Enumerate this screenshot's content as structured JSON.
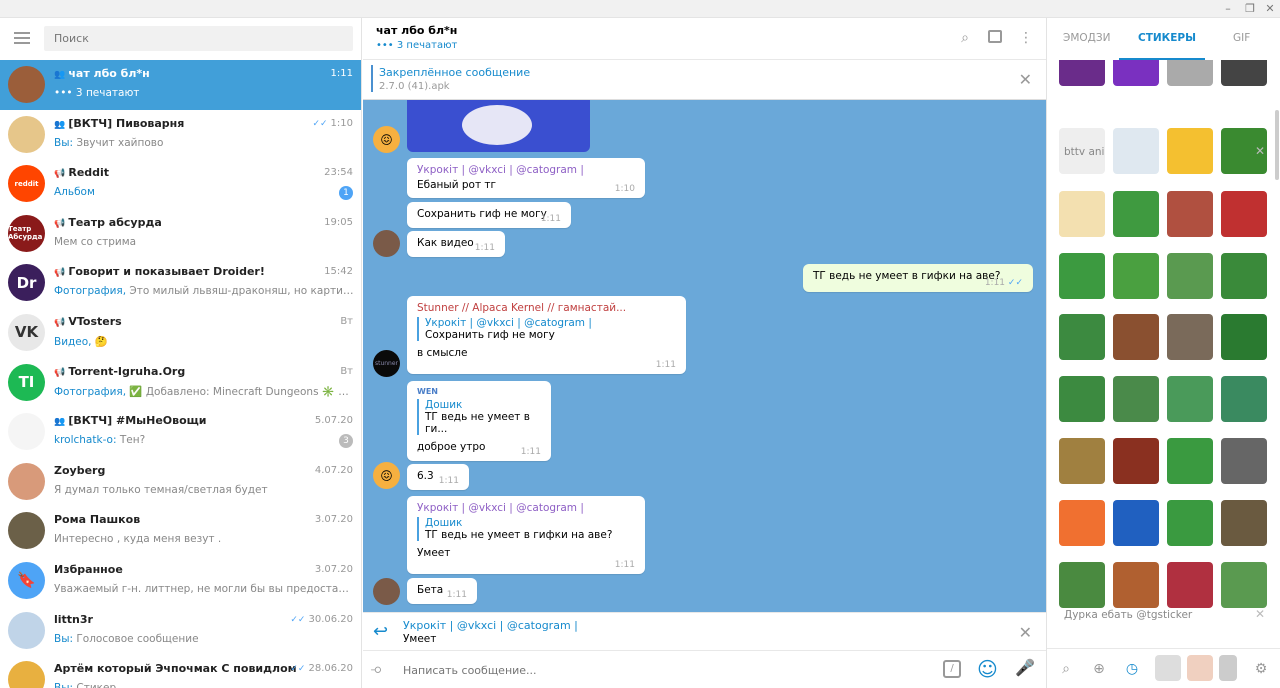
{
  "window": {
    "min": "–",
    "max": "❐",
    "close": "✕"
  },
  "sidebar": {
    "search_placeholder": "Поиск",
    "chats": [
      {
        "name": "чат лбо бл*н",
        "time": "1:11",
        "preview": "3 печатают",
        "color": "#9b5e3a",
        "initial": "",
        "group": true
      },
      {
        "name": "[ВКТЧ] Пивоварня",
        "time": "1:10",
        "preview_prefix": "Вы:",
        "preview": "Звучит хайпово",
        "color": "#e6c68a",
        "initial": "",
        "group": true,
        "read": true
      },
      {
        "name": "Reddit",
        "time": "23:54",
        "preview_prefix": "Альбом",
        "preview": "",
        "color": "#ff4500",
        "initial": "reddit",
        "channel": true,
        "badge": "1"
      },
      {
        "name": "Театр абсурда",
        "time": "19:05",
        "preview": "Мем со стрима",
        "color": "#8a1a1a",
        "initial": "Театр Абсурда",
        "channel": true
      },
      {
        "name": "Говорит и показывает Droider!",
        "time": "15:42",
        "preview_prefix": "Фотография,",
        "preview": "Это милый львяш-драконяш, но картинка не...",
        "color": "#3b1f5c",
        "initial": "Dr",
        "channel": true
      },
      {
        "name": "VTosters",
        "time": "Вт",
        "preview_prefix": "Видео,",
        "preview": "🤔",
        "color": "#e8e8e8",
        "initial": "VK",
        "channel": true
      },
      {
        "name": "Torrent-Igruha.Org",
        "time": "Вт",
        "preview_prefix": "Фотография,",
        "preview": "✅ Добавлено: Minecraft Dungeons ✳️ Изме...",
        "color": "#1db954",
        "initial": "TI",
        "channel": true
      },
      {
        "name": "[ВКТЧ] #МыНеОвощи",
        "time": "5.07.20",
        "preview_prefix": "krolchatk-o:",
        "preview": "Тен?",
        "color": "#f5f5f5",
        "initial": "",
        "group": true,
        "badge": "3",
        "badge_grey": true
      },
      {
        "name": "Zoyberg",
        "time": "4.07.20",
        "preview": "Я думал только темная/светлая будет",
        "color": "#d89a7a",
        "initial": ""
      },
      {
        "name": "Рома Пашков",
        "time": "3.07.20",
        "preview": "Интересно , куда меня везут .",
        "color": "#6b6048",
        "initial": ""
      },
      {
        "name": "Избранное",
        "time": "3.07.20",
        "preview": "Уважаемый г-н. литтнер, не могли бы вы предоставить фо...",
        "color": "#4ea4f6",
        "initial": "🔖"
      },
      {
        "name": "littn3r",
        "time": "30.06.20",
        "preview_prefix": "Вы:",
        "preview": "Голосовое сообщение",
        "color": "#c0d4e8",
        "initial": "",
        "read": true
      },
      {
        "name": "Артём который Эчпочмак С повидлом",
        "time": "28.06.20",
        "preview_prefix": "Вы:",
        "preview": "Стикер",
        "color": "#e8b040",
        "initial": "",
        "read": true
      }
    ]
  },
  "chat": {
    "title": "чат лбо бл*н",
    "status": "3 печатают",
    "pinned_title": "Закреплённое сообщение",
    "pinned_text": "2.7.0 (41).apk",
    "messages": [
      {
        "author": "Укрокіт | @vkxci | @catogram |",
        "text": "Ебаный рот тг",
        "time": "1:10"
      },
      {
        "text": "Сохранить гиф не могу",
        "time": "1:11"
      },
      {
        "text": "Как видео",
        "time": "1:11"
      },
      {
        "text": "ТГ ведь не умеет в гифки на аве?",
        "time": "1:11"
      },
      {
        "author": "Stunner // Alpaca Kernel // гамнастай...",
        "reply_name": "Укрокіт | @vkxci | @catogram |",
        "reply_text": "Сохранить гиф не могу",
        "text": "в смысле",
        "time": "1:11"
      },
      {
        "reply_name": "Дошик",
        "reply_text": "ТГ ведь не умеет в ги...",
        "text": "доброе утро",
        "time": "1:11"
      },
      {
        "text": "6.3",
        "time": "1:11"
      },
      {
        "author": "Укрокіт | @vkxci | @catogram |",
        "reply_name": "Дошик",
        "reply_text": "ТГ ведь не умеет в гифки на аве?",
        "text": "Умеет",
        "time": "1:11"
      },
      {
        "text": "Бета",
        "time": "1:11"
      }
    ],
    "reply_name": "Укрокіт | @vkxci | @catogram |",
    "reply_text": "Умеет",
    "input_placeholder": "Написать сообщение..."
  },
  "stickers": {
    "tabs": [
      "ЭМОДЗИ",
      "СТИКЕРЫ",
      "GIF"
    ],
    "sections": [
      "bttv ani",
      "Дурка ебать @tgsticker"
    ]
  }
}
